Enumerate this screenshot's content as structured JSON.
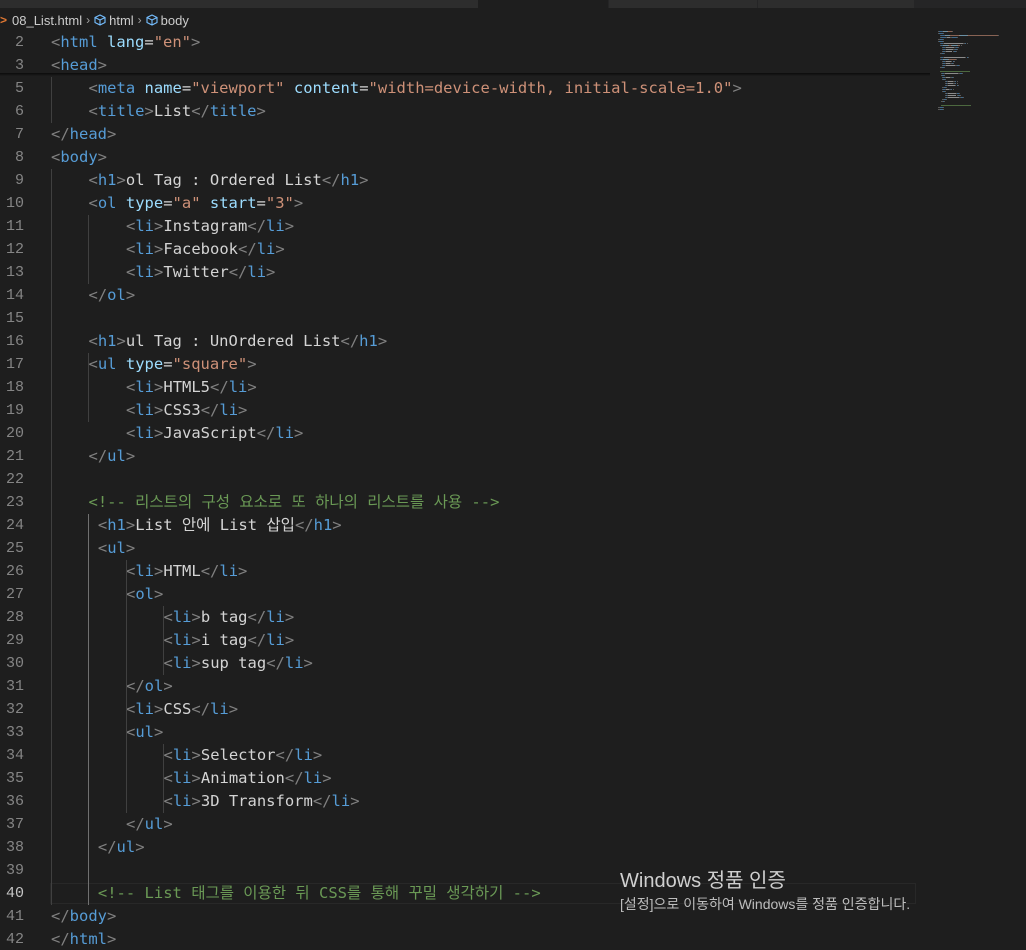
{
  "breadcrumb": {
    "file": "08_List.html",
    "items": [
      "html",
      "body"
    ]
  },
  "editor": {
    "lines": [
      {
        "n": "2",
        "indent": 0,
        "tokens": [
          [
            "b",
            "<"
          ],
          [
            "t",
            "html"
          ],
          [
            "x",
            " "
          ],
          [
            "a",
            "lang"
          ],
          [
            "x",
            "="
          ],
          [
            "s",
            "\"en\""
          ],
          [
            "b",
            ">"
          ]
        ]
      },
      {
        "n": "3",
        "indent": 0,
        "tokens": [
          [
            "b",
            "<"
          ],
          [
            "t",
            "head"
          ],
          [
            "b",
            ">"
          ]
        ]
      },
      {
        "n": "5",
        "indent": 1,
        "tokens": [
          [
            "b",
            "<"
          ],
          [
            "t",
            "meta"
          ],
          [
            "x",
            " "
          ],
          [
            "a",
            "name"
          ],
          [
            "x",
            "="
          ],
          [
            "s",
            "\"viewport\""
          ],
          [
            "x",
            " "
          ],
          [
            "a",
            "content"
          ],
          [
            "x",
            "="
          ],
          [
            "s",
            "\"width=device-width, initial-scale=1.0\""
          ],
          [
            "b",
            ">"
          ]
        ]
      },
      {
        "n": "6",
        "indent": 1,
        "tokens": [
          [
            "b",
            "<"
          ],
          [
            "t",
            "title"
          ],
          [
            "b",
            ">"
          ],
          [
            "x",
            "List"
          ],
          [
            "b",
            "</"
          ],
          [
            "t",
            "title"
          ],
          [
            "b",
            ">"
          ]
        ]
      },
      {
        "n": "7",
        "indent": 0,
        "tokens": [
          [
            "b",
            "</"
          ],
          [
            "t",
            "head"
          ],
          [
            "b",
            ">"
          ]
        ]
      },
      {
        "n": "8",
        "indent": 0,
        "tokens": [
          [
            "b",
            "<"
          ],
          [
            "t",
            "body"
          ],
          [
            "b",
            ">"
          ]
        ]
      },
      {
        "n": "9",
        "indent": 1,
        "tokens": [
          [
            "b",
            "<"
          ],
          [
            "t",
            "h1"
          ],
          [
            "b",
            ">"
          ],
          [
            "x",
            "ol Tag : Ordered List"
          ],
          [
            "b",
            "</"
          ],
          [
            "t",
            "h1"
          ],
          [
            "b",
            ">"
          ]
        ]
      },
      {
        "n": "10",
        "indent": 1,
        "tokens": [
          [
            "b",
            "<"
          ],
          [
            "t",
            "ol"
          ],
          [
            "x",
            " "
          ],
          [
            "a",
            "type"
          ],
          [
            "x",
            "="
          ],
          [
            "s",
            "\"a\""
          ],
          [
            "x",
            " "
          ],
          [
            "a",
            "start"
          ],
          [
            "x",
            "="
          ],
          [
            "s",
            "\"3\""
          ],
          [
            "b",
            ">"
          ]
        ]
      },
      {
        "n": "11",
        "indent": 2,
        "tokens": [
          [
            "b",
            "<"
          ],
          [
            "t",
            "li"
          ],
          [
            "b",
            ">"
          ],
          [
            "x",
            "Instagram"
          ],
          [
            "b",
            "</"
          ],
          [
            "t",
            "li"
          ],
          [
            "b",
            ">"
          ]
        ]
      },
      {
        "n": "12",
        "indent": 2,
        "tokens": [
          [
            "b",
            "<"
          ],
          [
            "t",
            "li"
          ],
          [
            "b",
            ">"
          ],
          [
            "x",
            "Facebook"
          ],
          [
            "b",
            "</"
          ],
          [
            "t",
            "li"
          ],
          [
            "b",
            ">"
          ]
        ]
      },
      {
        "n": "13",
        "indent": 2,
        "tokens": [
          [
            "b",
            "<"
          ],
          [
            "t",
            "li"
          ],
          [
            "b",
            ">"
          ],
          [
            "x",
            "Twitter"
          ],
          [
            "b",
            "</"
          ],
          [
            "t",
            "li"
          ],
          [
            "b",
            ">"
          ]
        ]
      },
      {
        "n": "14",
        "indent": 1,
        "tokens": [
          [
            "b",
            "</"
          ],
          [
            "t",
            "ol"
          ],
          [
            "b",
            ">"
          ]
        ]
      },
      {
        "n": "15",
        "indent": 0,
        "tokens": []
      },
      {
        "n": "16",
        "indent": 1,
        "tokens": [
          [
            "b",
            "<"
          ],
          [
            "t",
            "h1"
          ],
          [
            "b",
            ">"
          ],
          [
            "x",
            "ul Tag : UnOrdered List"
          ],
          [
            "b",
            "</"
          ],
          [
            "t",
            "h1"
          ],
          [
            "b",
            ">"
          ]
        ]
      },
      {
        "n": "17",
        "indent": 1,
        "tokens": [
          [
            "b",
            "<"
          ],
          [
            "t",
            "ul"
          ],
          [
            "x",
            " "
          ],
          [
            "a",
            "type"
          ],
          [
            "x",
            "="
          ],
          [
            "s",
            "\"square\""
          ],
          [
            "b",
            ">"
          ]
        ]
      },
      {
        "n": "18",
        "indent": 2,
        "tokens": [
          [
            "b",
            "<"
          ],
          [
            "t",
            "li"
          ],
          [
            "b",
            ">"
          ],
          [
            "x",
            "HTML5"
          ],
          [
            "b",
            "</"
          ],
          [
            "t",
            "li"
          ],
          [
            "b",
            ">"
          ]
        ]
      },
      {
        "n": "19",
        "indent": 2,
        "tokens": [
          [
            "b",
            "<"
          ],
          [
            "t",
            "li"
          ],
          [
            "b",
            ">"
          ],
          [
            "x",
            "CSS3"
          ],
          [
            "b",
            "</"
          ],
          [
            "t",
            "li"
          ],
          [
            "b",
            ">"
          ]
        ]
      },
      {
        "n": "20",
        "indent": 2,
        "tokens": [
          [
            "b",
            "<"
          ],
          [
            "t",
            "li"
          ],
          [
            "b",
            ">"
          ],
          [
            "x",
            "JavaScript"
          ],
          [
            "b",
            "</"
          ],
          [
            "t",
            "li"
          ],
          [
            "b",
            ">"
          ]
        ]
      },
      {
        "n": "21",
        "indent": 1,
        "tokens": [
          [
            "b",
            "</"
          ],
          [
            "t",
            "ul"
          ],
          [
            "b",
            ">"
          ]
        ]
      },
      {
        "n": "22",
        "indent": 0,
        "tokens": []
      },
      {
        "n": "23",
        "indent": 1,
        "tokens": [
          [
            "c",
            "<!-- 리스트의 구성 요소로 또 하나의 리스트를 사용 -->"
          ]
        ]
      },
      {
        "n": "24",
        "indent": 1.25,
        "tokens": [
          [
            "b",
            "<"
          ],
          [
            "t",
            "h1"
          ],
          [
            "b",
            ">"
          ],
          [
            "x",
            "List 안에 List 삽입"
          ],
          [
            "b",
            "</"
          ],
          [
            "t",
            "h1"
          ],
          [
            "b",
            ">"
          ]
        ]
      },
      {
        "n": "25",
        "indent": 1.25,
        "tokens": [
          [
            "b",
            "<"
          ],
          [
            "t",
            "ul"
          ],
          [
            "b",
            ">"
          ]
        ]
      },
      {
        "n": "26",
        "indent": 2,
        "tokens": [
          [
            "b",
            "<"
          ],
          [
            "t",
            "li"
          ],
          [
            "b",
            ">"
          ],
          [
            "x",
            "HTML"
          ],
          [
            "b",
            "</"
          ],
          [
            "t",
            "li"
          ],
          [
            "b",
            ">"
          ]
        ]
      },
      {
        "n": "27",
        "indent": 2,
        "tokens": [
          [
            "b",
            "<"
          ],
          [
            "t",
            "ol"
          ],
          [
            "b",
            ">"
          ]
        ]
      },
      {
        "n": "28",
        "indent": 3,
        "tokens": [
          [
            "b",
            "<"
          ],
          [
            "t",
            "li"
          ],
          [
            "b",
            ">"
          ],
          [
            "x",
            "b tag"
          ],
          [
            "b",
            "</"
          ],
          [
            "t",
            "li"
          ],
          [
            "b",
            ">"
          ]
        ]
      },
      {
        "n": "29",
        "indent": 3,
        "tokens": [
          [
            "b",
            "<"
          ],
          [
            "t",
            "li"
          ],
          [
            "b",
            ">"
          ],
          [
            "x",
            "i tag"
          ],
          [
            "b",
            "</"
          ],
          [
            "t",
            "li"
          ],
          [
            "b",
            ">"
          ]
        ]
      },
      {
        "n": "30",
        "indent": 3,
        "tokens": [
          [
            "b",
            "<"
          ],
          [
            "t",
            "li"
          ],
          [
            "b",
            ">"
          ],
          [
            "x",
            "sup tag"
          ],
          [
            "b",
            "</"
          ],
          [
            "t",
            "li"
          ],
          [
            "b",
            ">"
          ]
        ]
      },
      {
        "n": "31",
        "indent": 2,
        "tokens": [
          [
            "b",
            "</"
          ],
          [
            "t",
            "ol"
          ],
          [
            "b",
            ">"
          ]
        ]
      },
      {
        "n": "32",
        "indent": 2,
        "tokens": [
          [
            "b",
            "<"
          ],
          [
            "t",
            "li"
          ],
          [
            "b",
            ">"
          ],
          [
            "x",
            "CSS"
          ],
          [
            "b",
            "</"
          ],
          [
            "t",
            "li"
          ],
          [
            "b",
            ">"
          ]
        ]
      },
      {
        "n": "33",
        "indent": 2,
        "tokens": [
          [
            "b",
            "<"
          ],
          [
            "t",
            "ul"
          ],
          [
            "b",
            ">"
          ]
        ]
      },
      {
        "n": "34",
        "indent": 3,
        "tokens": [
          [
            "b",
            "<"
          ],
          [
            "t",
            "li"
          ],
          [
            "b",
            ">"
          ],
          [
            "x",
            "Selector"
          ],
          [
            "b",
            "</"
          ],
          [
            "t",
            "li"
          ],
          [
            "b",
            ">"
          ]
        ]
      },
      {
        "n": "35",
        "indent": 3,
        "tokens": [
          [
            "b",
            "<"
          ],
          [
            "t",
            "li"
          ],
          [
            "b",
            ">"
          ],
          [
            "x",
            "Animation"
          ],
          [
            "b",
            "</"
          ],
          [
            "t",
            "li"
          ],
          [
            "b",
            ">"
          ]
        ]
      },
      {
        "n": "36",
        "indent": 3,
        "tokens": [
          [
            "b",
            "<"
          ],
          [
            "t",
            "li"
          ],
          [
            "b",
            ">"
          ],
          [
            "x",
            "3D Transform"
          ],
          [
            "b",
            "</"
          ],
          [
            "t",
            "li"
          ],
          [
            "b",
            ">"
          ]
        ]
      },
      {
        "n": "37",
        "indent": 2,
        "tokens": [
          [
            "b",
            "</"
          ],
          [
            "t",
            "ul"
          ],
          [
            "b",
            ">"
          ]
        ]
      },
      {
        "n": "38",
        "indent": 1.25,
        "tokens": [
          [
            "b",
            "</"
          ],
          [
            "t",
            "ul"
          ],
          [
            "b",
            ">"
          ]
        ]
      },
      {
        "n": "39",
        "indent": 0,
        "tokens": []
      },
      {
        "n": "40",
        "indent": 1.25,
        "active": true,
        "tokens": [
          [
            "c",
            "<!-- List 태그를 이용한 뒤 CSS를 통해 꾸밀 생각하기 -->"
          ]
        ]
      },
      {
        "n": "41",
        "indent": 0,
        "tokens": [
          [
            "b",
            "</"
          ],
          [
            "t",
            "body"
          ],
          [
            "b",
            ">"
          ]
        ]
      },
      {
        "n": "42",
        "indent": 0,
        "tokens": [
          [
            "b",
            "</"
          ],
          [
            "t",
            "html"
          ],
          [
            "b",
            ">"
          ]
        ]
      }
    ]
  },
  "watermark": {
    "title": "Windows 정품 인증",
    "subtitle": "[설정]으로 이동하여 Windows를 정품 인증합니다."
  },
  "colors": {
    "background": "#1e1e1e",
    "tag": "#569cd6",
    "bracket": "#808080",
    "attribute": "#9cdcfe",
    "string": "#ce9178",
    "text": "#d4d4d4",
    "comment": "#6a9955",
    "line_number": "#858585"
  }
}
